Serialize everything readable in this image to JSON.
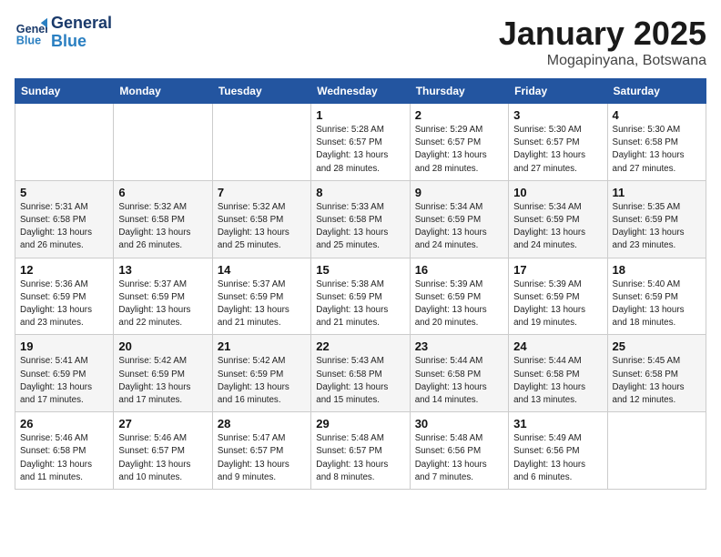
{
  "logo": {
    "line1": "General",
    "line2": "Blue"
  },
  "title": "January 2025",
  "location": "Mogapinyana, Botswana",
  "weekdays": [
    "Sunday",
    "Monday",
    "Tuesday",
    "Wednesday",
    "Thursday",
    "Friday",
    "Saturday"
  ],
  "weeks": [
    [
      {
        "day": "",
        "info": ""
      },
      {
        "day": "",
        "info": ""
      },
      {
        "day": "",
        "info": ""
      },
      {
        "day": "1",
        "info": "Sunrise: 5:28 AM\nSunset: 6:57 PM\nDaylight: 13 hours\nand 28 minutes."
      },
      {
        "day": "2",
        "info": "Sunrise: 5:29 AM\nSunset: 6:57 PM\nDaylight: 13 hours\nand 28 minutes."
      },
      {
        "day": "3",
        "info": "Sunrise: 5:30 AM\nSunset: 6:57 PM\nDaylight: 13 hours\nand 27 minutes."
      },
      {
        "day": "4",
        "info": "Sunrise: 5:30 AM\nSunset: 6:58 PM\nDaylight: 13 hours\nand 27 minutes."
      }
    ],
    [
      {
        "day": "5",
        "info": "Sunrise: 5:31 AM\nSunset: 6:58 PM\nDaylight: 13 hours\nand 26 minutes."
      },
      {
        "day": "6",
        "info": "Sunrise: 5:32 AM\nSunset: 6:58 PM\nDaylight: 13 hours\nand 26 minutes."
      },
      {
        "day": "7",
        "info": "Sunrise: 5:32 AM\nSunset: 6:58 PM\nDaylight: 13 hours\nand 25 minutes."
      },
      {
        "day": "8",
        "info": "Sunrise: 5:33 AM\nSunset: 6:58 PM\nDaylight: 13 hours\nand 25 minutes."
      },
      {
        "day": "9",
        "info": "Sunrise: 5:34 AM\nSunset: 6:59 PM\nDaylight: 13 hours\nand 24 minutes."
      },
      {
        "day": "10",
        "info": "Sunrise: 5:34 AM\nSunset: 6:59 PM\nDaylight: 13 hours\nand 24 minutes."
      },
      {
        "day": "11",
        "info": "Sunrise: 5:35 AM\nSunset: 6:59 PM\nDaylight: 13 hours\nand 23 minutes."
      }
    ],
    [
      {
        "day": "12",
        "info": "Sunrise: 5:36 AM\nSunset: 6:59 PM\nDaylight: 13 hours\nand 23 minutes."
      },
      {
        "day": "13",
        "info": "Sunrise: 5:37 AM\nSunset: 6:59 PM\nDaylight: 13 hours\nand 22 minutes."
      },
      {
        "day": "14",
        "info": "Sunrise: 5:37 AM\nSunset: 6:59 PM\nDaylight: 13 hours\nand 21 minutes."
      },
      {
        "day": "15",
        "info": "Sunrise: 5:38 AM\nSunset: 6:59 PM\nDaylight: 13 hours\nand 21 minutes."
      },
      {
        "day": "16",
        "info": "Sunrise: 5:39 AM\nSunset: 6:59 PM\nDaylight: 13 hours\nand 20 minutes."
      },
      {
        "day": "17",
        "info": "Sunrise: 5:39 AM\nSunset: 6:59 PM\nDaylight: 13 hours\nand 19 minutes."
      },
      {
        "day": "18",
        "info": "Sunrise: 5:40 AM\nSunset: 6:59 PM\nDaylight: 13 hours\nand 18 minutes."
      }
    ],
    [
      {
        "day": "19",
        "info": "Sunrise: 5:41 AM\nSunset: 6:59 PM\nDaylight: 13 hours\nand 17 minutes."
      },
      {
        "day": "20",
        "info": "Sunrise: 5:42 AM\nSunset: 6:59 PM\nDaylight: 13 hours\nand 17 minutes."
      },
      {
        "day": "21",
        "info": "Sunrise: 5:42 AM\nSunset: 6:59 PM\nDaylight: 13 hours\nand 16 minutes."
      },
      {
        "day": "22",
        "info": "Sunrise: 5:43 AM\nSunset: 6:58 PM\nDaylight: 13 hours\nand 15 minutes."
      },
      {
        "day": "23",
        "info": "Sunrise: 5:44 AM\nSunset: 6:58 PM\nDaylight: 13 hours\nand 14 minutes."
      },
      {
        "day": "24",
        "info": "Sunrise: 5:44 AM\nSunset: 6:58 PM\nDaylight: 13 hours\nand 13 minutes."
      },
      {
        "day": "25",
        "info": "Sunrise: 5:45 AM\nSunset: 6:58 PM\nDaylight: 13 hours\nand 12 minutes."
      }
    ],
    [
      {
        "day": "26",
        "info": "Sunrise: 5:46 AM\nSunset: 6:58 PM\nDaylight: 13 hours\nand 11 minutes."
      },
      {
        "day": "27",
        "info": "Sunrise: 5:46 AM\nSunset: 6:57 PM\nDaylight: 13 hours\nand 10 minutes."
      },
      {
        "day": "28",
        "info": "Sunrise: 5:47 AM\nSunset: 6:57 PM\nDaylight: 13 hours\nand 9 minutes."
      },
      {
        "day": "29",
        "info": "Sunrise: 5:48 AM\nSunset: 6:57 PM\nDaylight: 13 hours\nand 8 minutes."
      },
      {
        "day": "30",
        "info": "Sunrise: 5:48 AM\nSunset: 6:56 PM\nDaylight: 13 hours\nand 7 minutes."
      },
      {
        "day": "31",
        "info": "Sunrise: 5:49 AM\nSunset: 6:56 PM\nDaylight: 13 hours\nand 6 minutes."
      },
      {
        "day": "",
        "info": ""
      }
    ]
  ]
}
